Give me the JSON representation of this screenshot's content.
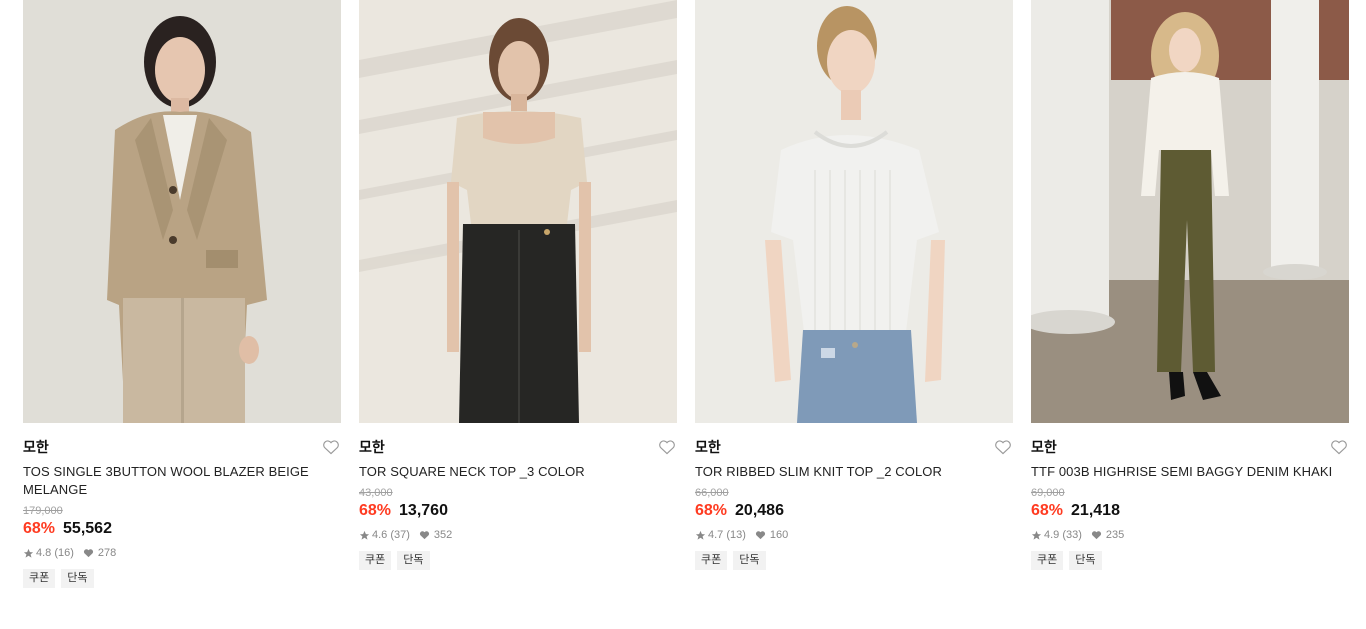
{
  "products": [
    {
      "brand": "모한",
      "name": "TOS SINGLE 3BUTTON WOOL BLAZER BEIGE MELANGE",
      "original_price": "179,000",
      "discount": "68%",
      "price": "55,562",
      "rating": "4.8",
      "reviews": "(16)",
      "likes": "278",
      "tags": [
        "쿠폰",
        "단독"
      ]
    },
    {
      "brand": "모한",
      "name": "TOR SQUARE NECK TOP _3 COLOR",
      "original_price": "43,000",
      "discount": "68%",
      "price": "13,760",
      "rating": "4.6",
      "reviews": "(37)",
      "likes": "352",
      "tags": [
        "쿠폰",
        "단독"
      ]
    },
    {
      "brand": "모한",
      "name": "TOR RIBBED SLIM KNIT TOP _2 COLOR",
      "original_price": "66,000",
      "discount": "68%",
      "price": "20,486",
      "rating": "4.7",
      "reviews": "(13)",
      "likes": "160",
      "tags": [
        "쿠폰",
        "단독"
      ]
    },
    {
      "brand": "모한",
      "name": "TTF 003B HIGHRISE SEMI BAGGY DENIM KHAKI",
      "original_price": "69,000",
      "discount": "68%",
      "price": "21,418",
      "rating": "4.9",
      "reviews": "(33)",
      "likes": "235",
      "tags": [
        "쿠폰",
        "단독"
      ]
    }
  ],
  "colors": {
    "discount": "#ff3b21",
    "muted": "#888888",
    "tag_bg": "#f2f2f2"
  }
}
